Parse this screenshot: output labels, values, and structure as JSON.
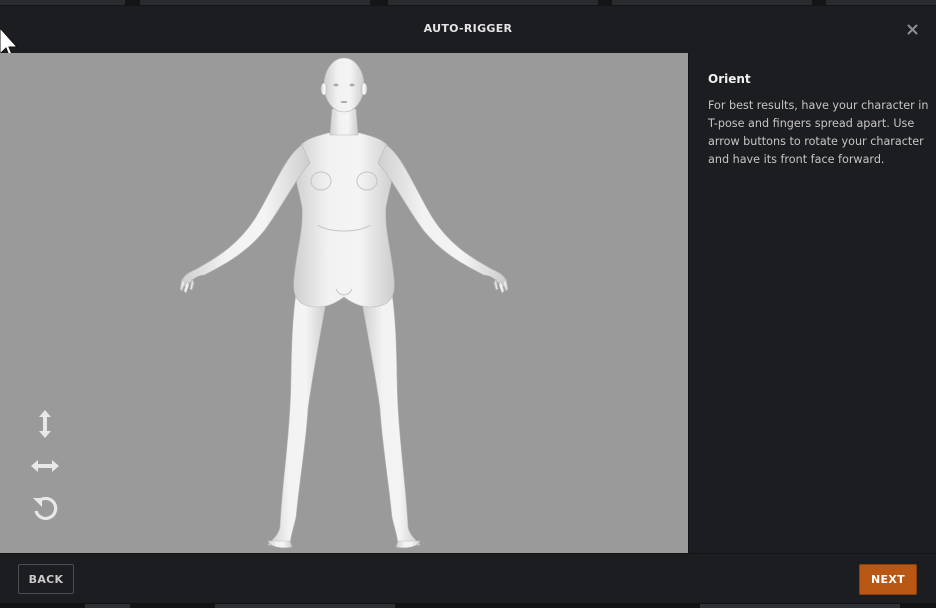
{
  "window": {
    "title": "AUTO-RIGGER",
    "close_icon": "close-icon"
  },
  "viewport": {
    "background_color": "#9a9a9a",
    "model": "humanoid-character-model",
    "tools": [
      {
        "name": "move-vertical-icon"
      },
      {
        "name": "move-horizontal-icon"
      },
      {
        "name": "rotate-icon"
      }
    ]
  },
  "panel": {
    "title": "Orient",
    "description": "For best results, have your character in T-pose and fingers spread apart. Use arrow buttons to rotate your character and have its front face forward."
  },
  "footer": {
    "back_label": "BACK",
    "next_label": "NEXT"
  },
  "colors": {
    "accent": "#b85814",
    "panel_bg": "#1c1d20"
  }
}
